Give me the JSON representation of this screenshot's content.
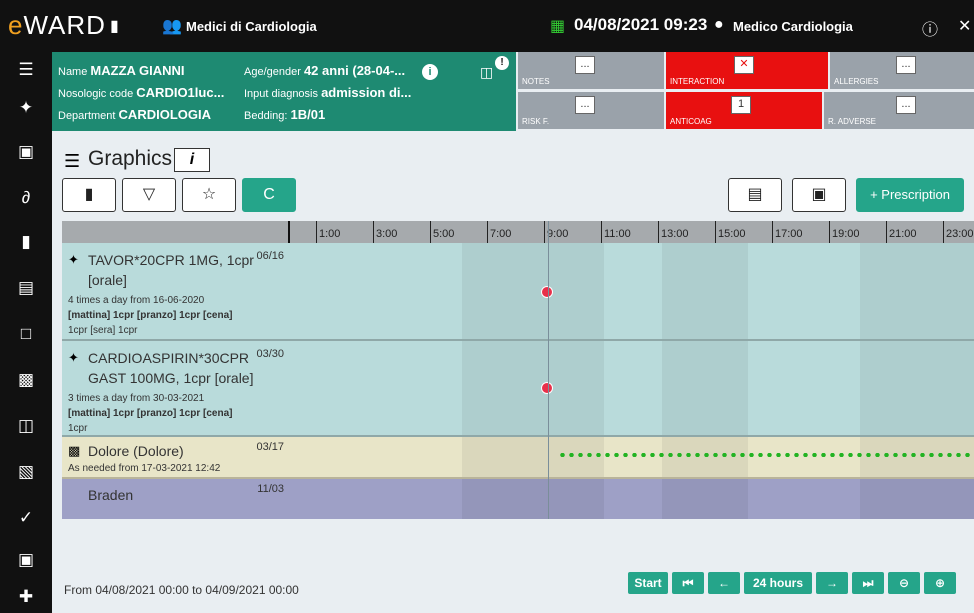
{
  "app": {
    "logo": "WARD",
    "ward_name": "Medici di Cardiologia",
    "datetime": "04/08/2021 09:23",
    "user": "Medico Cardiologia"
  },
  "patient": {
    "name_label": "Name",
    "name": "MAZZA GIANNI",
    "age_label": "Age/gender",
    "age": "42 anni (28-04-...",
    "nosologic_label": "Nosologic code",
    "nosologic": "CARDIO1luc...",
    "diagnosis_label": "Input diagnosis",
    "diagnosis": "admission di...",
    "department_label": "Department",
    "department": "CARDIOLOGIA",
    "bedding_label": "Bedding:",
    "bedding": "1B/01"
  },
  "alerts": [
    {
      "label": "NOTES",
      "box": "...",
      "color": "#9aa2aa"
    },
    {
      "label": "INTERACTION",
      "box": "✕",
      "color": "#e81010"
    },
    {
      "label": "ALLERGIES",
      "box": "...",
      "color": "#9aa2aa"
    },
    {
      "label": "RISK F.",
      "box": "...",
      "color": "#9aa2aa"
    },
    {
      "label": "ANTICOAG",
      "box": "1",
      "color": "#e81010"
    },
    {
      "label": "R. ADVERSE",
      "box": "...",
      "color": "#9aa2aa"
    }
  ],
  "graphics": {
    "title": "Graphics",
    "info": "i",
    "refresh": "C",
    "prescription": "+ Prescription"
  },
  "timeline": {
    "ticks": [
      "1:00",
      "3:00",
      "5:00",
      "7:00",
      "9:00",
      "11:00",
      "13:00",
      "15:00",
      "17:00",
      "19:00",
      "21:00",
      "23:00"
    ],
    "current_time_fraction": 0.39
  },
  "rows": [
    {
      "name": "TAVOR*20CPR 1MG, 1cpr [orale]",
      "count": "06/16",
      "lines": [
        "4 times a day from 16-06-2020",
        "[mattina] 1cpr [pranzo] 1cpr [cena]",
        "1cpr [sera] 1cpr"
      ]
    },
    {
      "name": "CARDIOASPIRIN*30CPR GAST 100MG, 1cpr [orale]",
      "count": "03/30",
      "lines": [
        "3 times a day from 30-03-2021",
        "[mattina] 1cpr [pranzo] 1cpr [cena]",
        "1cpr"
      ]
    },
    {
      "name": "Dolore (Dolore)",
      "count": "03/17",
      "lines": [
        "As needed from 17-03-2021 12:42"
      ]
    },
    {
      "name": "Braden",
      "count": "11/03",
      "lines": []
    }
  ],
  "footer": {
    "range": "From 04/08/2021 00:00 to 04/09/2021 00:00",
    "start": "Start",
    "hours": "24 hours"
  }
}
